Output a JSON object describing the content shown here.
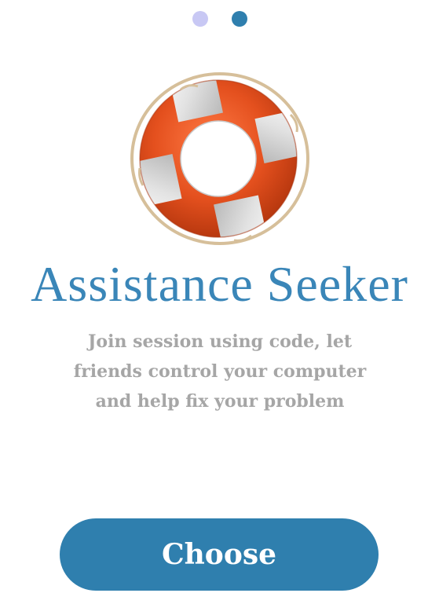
{
  "pager": {
    "dots": [
      "inactive",
      "active"
    ],
    "colors": {
      "inactive": "#c8c8f4",
      "active": "#2f7fae"
    }
  },
  "hero": {
    "icon": "lifebuoy-icon",
    "colors": {
      "ring": "#e4501e",
      "bands": "#e6e6e6",
      "rope": "#d6bf9a"
    }
  },
  "title": "Assistance Seeker",
  "description": "Join session using code, let friends control your computer and help fix your problem",
  "choose_button": {
    "label": "Choose",
    "color": "#2f7fae"
  }
}
